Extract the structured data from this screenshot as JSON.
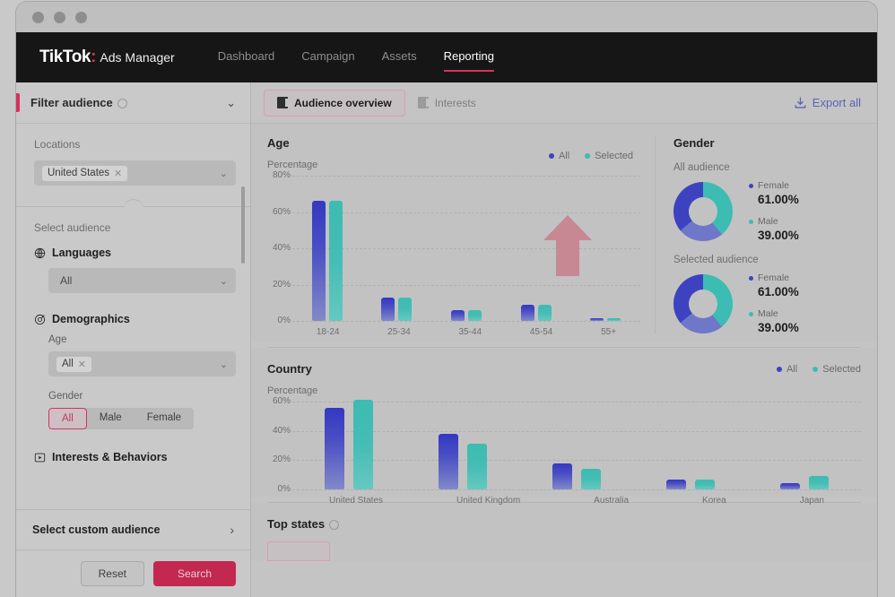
{
  "window": {
    "dots": 3
  },
  "nav": {
    "logo_main": "TikTok",
    "logo_colon": ":",
    "logo_sub": "Ads Manager",
    "links": [
      {
        "label": "Dashboard",
        "active": false
      },
      {
        "label": "Campaign",
        "active": false
      },
      {
        "label": "Assets",
        "active": false
      },
      {
        "label": "Reporting",
        "active": true
      }
    ]
  },
  "sidebar": {
    "header": "Filter audience",
    "locations_label": "Locations",
    "location_token": "United States",
    "select_audience_label": "Select audience",
    "languages_label": "Languages",
    "languages_value": "All",
    "demographics_label": "Demographics",
    "age_label": "Age",
    "age_token": "All",
    "gender_label": "Gender",
    "gender_options": [
      {
        "label": "All",
        "active": true
      },
      {
        "label": "Male",
        "active": false
      },
      {
        "label": "Female",
        "active": false
      }
    ],
    "interests_label": "Interests & Behaviors",
    "custom_audience_label": "Select custom audience",
    "reset_label": "Reset",
    "search_label": "Search"
  },
  "tabs": [
    {
      "label": "Audience overview",
      "active": true
    },
    {
      "label": "Interests",
      "active": false
    }
  ],
  "export_label": "Export all",
  "legend": [
    {
      "label": "All",
      "color": "#3d43c0"
    },
    {
      "label": "Selected",
      "color": "#3cbcb2"
    }
  ],
  "gender": {
    "title": "Gender",
    "groups": [
      {
        "label": "All audience",
        "items": [
          {
            "name": "Female",
            "value": "61.00%",
            "color": "#3d43c0"
          },
          {
            "name": "Male",
            "value": "39.00%",
            "color": "#3cbcb2"
          }
        ]
      },
      {
        "label": "Selected audience",
        "items": [
          {
            "name": "Female",
            "value": "61.00%",
            "color": "#3d43c0"
          },
          {
            "name": "Male",
            "value": "39.00%",
            "color": "#3cbcb2"
          }
        ]
      }
    ]
  },
  "top_states": {
    "title": "Top states"
  },
  "chart_data": [
    {
      "type": "bar",
      "title": "Age",
      "ylabel": "Percentage",
      "xlabel": "",
      "categories": [
        "18-24",
        "25-34",
        "35-44",
        "45-54",
        "55+"
      ],
      "yticks": [
        "0%",
        "20%",
        "40%",
        "60%",
        "80%"
      ],
      "ylim": [
        0,
        80
      ],
      "grid": true,
      "legend_position": "top-right",
      "series": [
        {
          "name": "All",
          "color": "#3d43c0",
          "values": [
            66,
            13,
            6,
            9,
            1
          ]
        },
        {
          "name": "Selected",
          "color": "#3cbcb2",
          "values": [
            66,
            13,
            6,
            9,
            1
          ]
        }
      ]
    },
    {
      "type": "bar",
      "title": "Country",
      "ylabel": "Percentage",
      "xlabel": "",
      "categories": [
        "United States",
        "United Kingdom",
        "Australia",
        "Korea",
        "Japan"
      ],
      "yticks": [
        "0%",
        "20%",
        "40%",
        "60%"
      ],
      "ylim": [
        0,
        60
      ],
      "grid": true,
      "legend_position": "top-right",
      "series": [
        {
          "name": "All",
          "color": "#3d43c0",
          "values": [
            56,
            38,
            18,
            7,
            4.5
          ]
        },
        {
          "name": "Selected",
          "color": "#3cbcb2",
          "values": [
            61,
            31,
            14,
            7,
            9.5
          ]
        }
      ]
    }
  ]
}
